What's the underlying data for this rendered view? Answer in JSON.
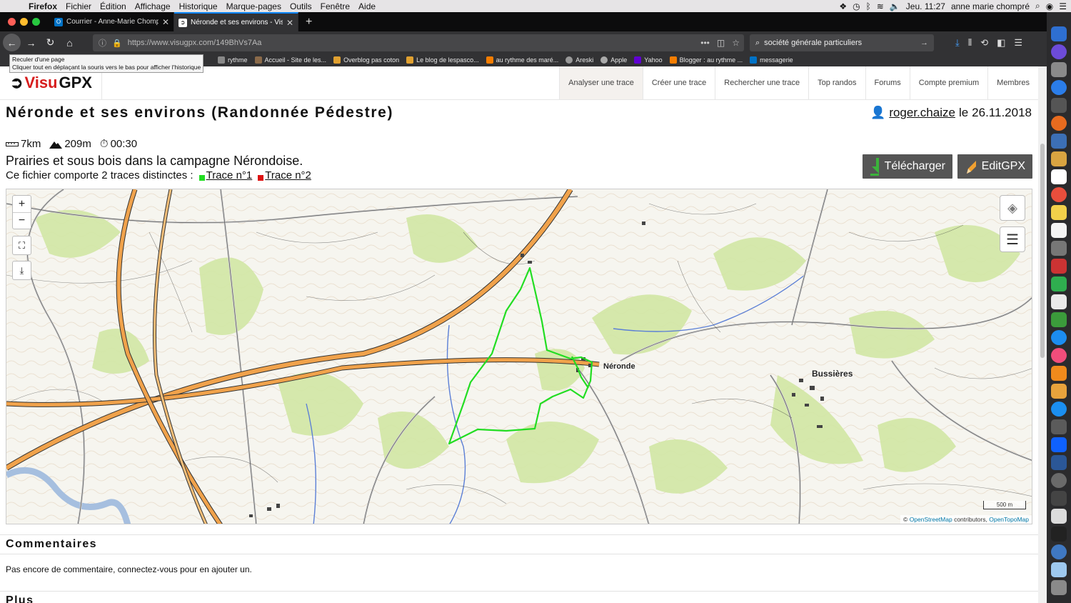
{
  "menubar": {
    "app": "Firefox",
    "items": [
      "Fichier",
      "Édition",
      "Affichage",
      "Historique",
      "Marque-pages",
      "Outils",
      "Fenêtre",
      "Aide"
    ],
    "clock": "Jeu. 11:27",
    "user": "anne marie chompré"
  },
  "tabs": [
    {
      "title": "Courrier - Anne-Marie Chompré",
      "active": false,
      "favicon_color": "#0072c6"
    },
    {
      "title": "Néronde et ses environs - Visu",
      "active": true,
      "favicon_color": "#111111"
    }
  ],
  "toolbar": {
    "url": "https://www.visugpx.com/149BhVs7Aa",
    "search_value": "société générale particuliers"
  },
  "tooltip": {
    "line1": "Reculer d'une page",
    "line2": "Cliquer tout en déplaçant la souris vers le bas pour afficher l'historique"
  },
  "bookmarks": [
    {
      "label": "rythme",
      "color": "#888888"
    },
    {
      "label": "Accueil - Site de les...",
      "color": "#8a6a4a"
    },
    {
      "label": "Overblog pas coton",
      "color": "#e0a030"
    },
    {
      "label": "Le blog de lespasco...",
      "color": "#e0a030"
    },
    {
      "label": "au rythme des maré...",
      "color": "#f57d00"
    },
    {
      "label": "Areski",
      "color": "#999999"
    },
    {
      "label": "Apple",
      "color": "#aaaaaa"
    },
    {
      "label": "Yahoo",
      "color": "#6001d2"
    },
    {
      "label": "Blogger : au rythme ...",
      "color": "#f57d00"
    },
    {
      "label": "messagerie",
      "color": "#0072c6"
    }
  ],
  "site": {
    "logo_visu": "Visu",
    "logo_gpx": "GPX",
    "nav": [
      "Analyser une trace",
      "Créer une trace",
      "Rechercher une trace",
      "Top randos",
      "Forums",
      "Compte premium",
      "Membres"
    ],
    "active_nav": 0
  },
  "track": {
    "title": "Néronde et ses environs (Randonnée Pédestre)",
    "author": "roger.chaize",
    "date_prefix": "le",
    "date": "26.11.2018",
    "distance": "7km",
    "elevation": "209m",
    "duration": "00:30",
    "description": "Prairies et sous bois dans la campagne Nérondoise.",
    "traces_label": "Ce fichier comporte 2 traces distinctes :",
    "traces": [
      {
        "label": "Trace n°1",
        "color": "#22dd22"
      },
      {
        "label": "Trace n°2",
        "color": "#dd1111"
      }
    ]
  },
  "buttons": {
    "download": "Télécharger",
    "editgpx": "EditGPX"
  },
  "map": {
    "zoom_in": "+",
    "zoom_out": "−",
    "places": [
      "Néronde",
      "Bussières"
    ],
    "scale": "500 m",
    "attribution_prefix": "©",
    "attribution_osm": "OpenStreetMap",
    "attribution_mid": "contributors,",
    "attribution_otm": "OpenTopoMap",
    "trace_color": "#22dd22"
  },
  "comments": {
    "heading": "Commentaires",
    "text": "Pas encore de commentaire, connectez-vous pour en ajouter un."
  },
  "more": {
    "heading": "Plus"
  }
}
